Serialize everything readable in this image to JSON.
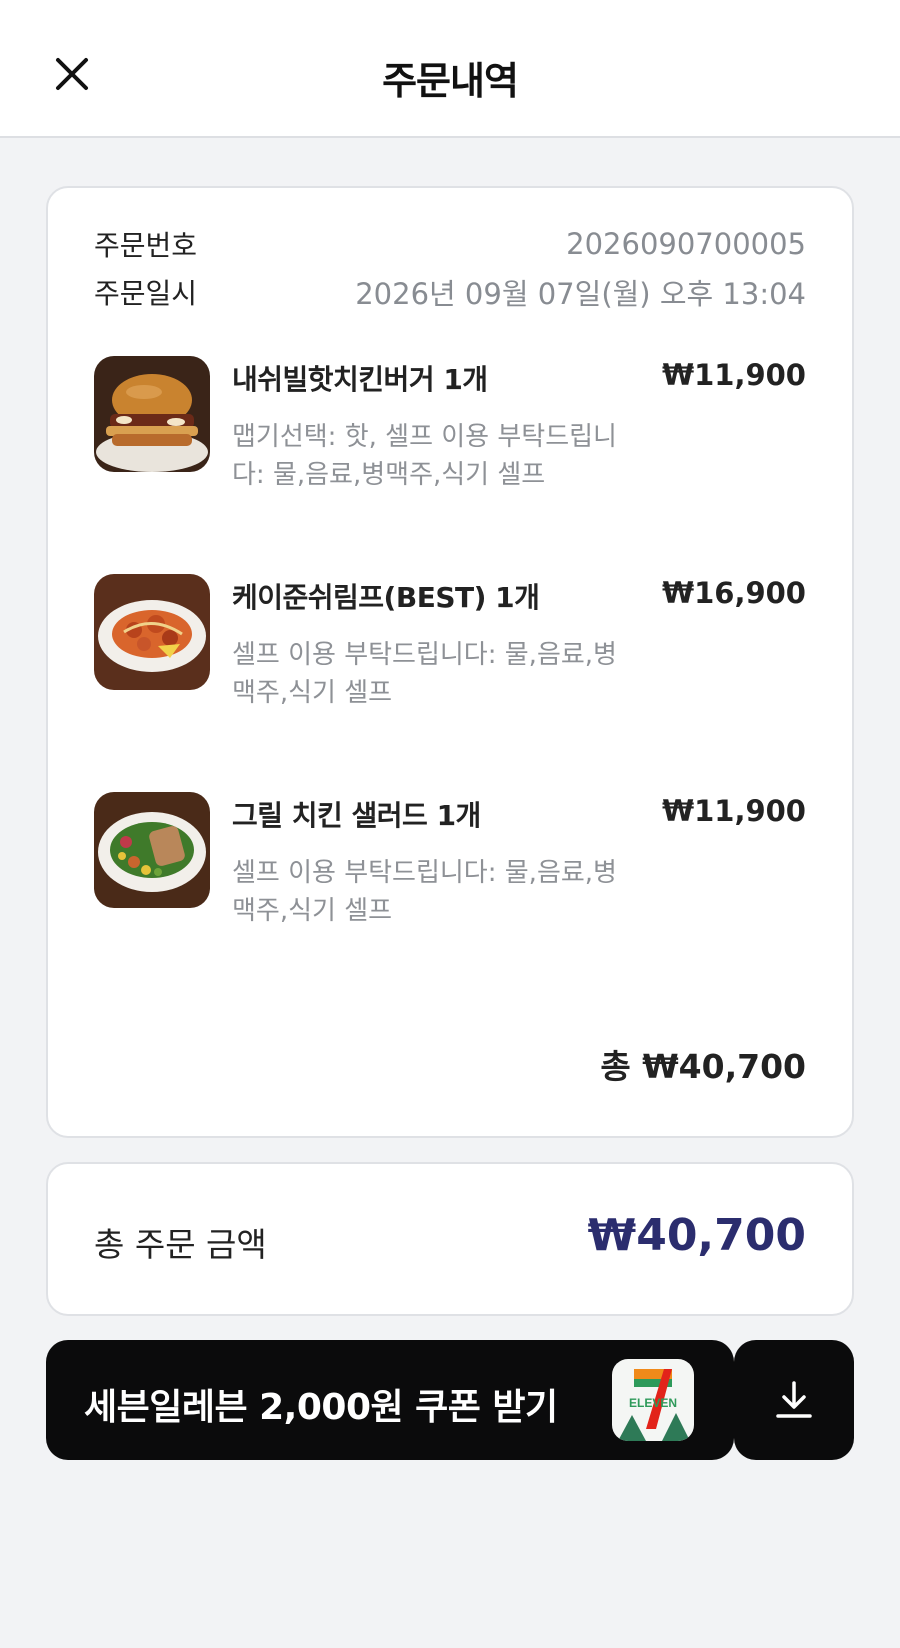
{
  "header": {
    "title": "주문내역",
    "close_icon": "close-icon"
  },
  "order": {
    "number_label": "주문번호",
    "number_value": "2026090700005",
    "date_label": "주문일시",
    "date_value": "2026년 09월 07일(월) 오후 13:04",
    "items": [
      {
        "name": "내쉬빌핫치킨버거 1개",
        "price": "₩11,900",
        "options": "맵기선택: 핫, 셀프 이용 부탁드립니다: 물,음료,병맥주,식기 셀프",
        "image": "burger-image"
      },
      {
        "name": "케이준쉬림프(BEST) 1개",
        "price": "₩16,900",
        "options": "셀프 이용 부탁드립니다: 물,음료,병맥주,식기 셀프",
        "image": "shrimp-image"
      },
      {
        "name": "그릴 치킨 샐러드 1개",
        "price": "₩11,900",
        "options": "셀프 이용 부탁드립니다: 물,음료,병맥주,식기 셀프",
        "image": "salad-image"
      }
    ],
    "subtotal": "총 ₩40,700"
  },
  "total": {
    "label": "총 주문 금액",
    "value": "₩40,700",
    "color": "#2b2d6e"
  },
  "coupon": {
    "label": "세븐일레븐 2,000원 쿠폰 받기",
    "logo_text": "ELEVEN",
    "logo_number": "7",
    "download_icon": "download-icon"
  },
  "colors": {
    "background": "#f2f3f5",
    "card": "#ffffff",
    "button": "#0b0b0c",
    "muted": "#888c92"
  }
}
